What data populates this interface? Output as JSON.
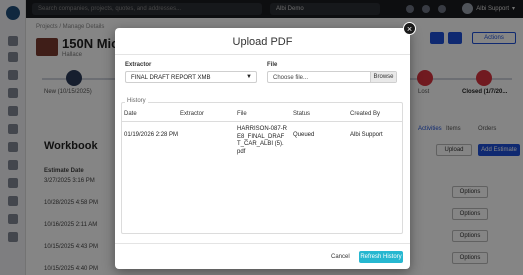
{
  "topbar": {
    "search_placeholder": "Search companies, projects, quotes, and addresses...",
    "tenant": "Albi Demo",
    "user_name": "Albi Support"
  },
  "background": {
    "breadcrumb": "Projects / Manage Details",
    "project_title": "150N Michig",
    "project_subtitle": "Hallace",
    "stage_new": "New (10/15/2025)",
    "stage_lost": "Lost",
    "stage_closed": "Closed (1/7/20...",
    "workbook_title": "Workbook",
    "col_estimate_date": "Estimate Date",
    "rows": [
      "3/27/2025 3:16 PM",
      "10/28/2025 4:58 PM",
      "10/16/2025 2:11 AM",
      "10/15/2025 4:43 PM",
      "10/15/2025 4:40 PM"
    ],
    "tab_activities": "Activities",
    "tab_items": "Items",
    "tab_orders": "Orders",
    "btn_actions": "Actions",
    "btn_options": "Options",
    "btn_add_estimate": "Add Estimate",
    "btn_upload": "Upload"
  },
  "modal": {
    "title": "Upload PDF",
    "close_label": "×",
    "extractor_label": "Extractor",
    "extractor_value": "FINAL DRAFT REPORT XMB",
    "file_label": "File",
    "file_placeholder": "Choose file...",
    "browse_label": "Browse",
    "history_label": "History",
    "columns": [
      "Date",
      "Extractor",
      "File",
      "Status",
      "Created By"
    ],
    "history_row": {
      "date": "01/19/2026 2:28 PM",
      "extractor": "",
      "file": "HARRISON-087-RE8_FINAL_DRAFT_CAR_ALBI (5).pdf",
      "status": "Queued",
      "created_by": "Albi Support"
    },
    "cancel_label": "Cancel",
    "refresh_label": "Refresh History"
  },
  "colors": {
    "accent": "#26b7d0",
    "topbar": "#1a1c20",
    "stage_red": "#d9323f",
    "primary_blue": "#1d4fd8"
  }
}
